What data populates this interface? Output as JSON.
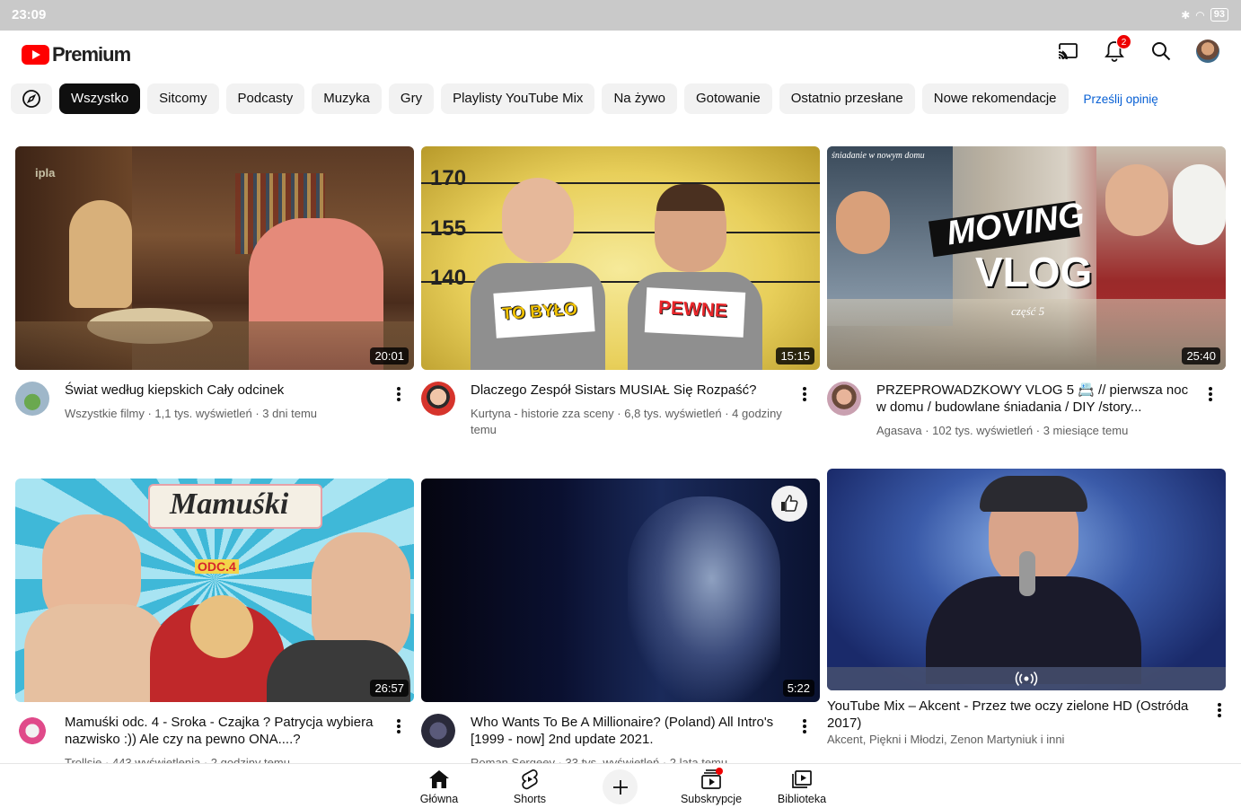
{
  "status_bar": {
    "time": "23:09",
    "battery": "93"
  },
  "header": {
    "logo_text": "Premium",
    "notification_count": "2"
  },
  "chips": {
    "items": [
      "Wszystko",
      "Sitcomy",
      "Podcasty",
      "Muzyka",
      "Gry",
      "Playlisty YouTube Mix",
      "Na żywo",
      "Gotowanie",
      "Ostatnio przesłane",
      "Nowe rekomendacje"
    ],
    "feedback_link": "Prześlij opinię"
  },
  "videos": [
    {
      "title": "Świat według kiepskich Cały odcinek",
      "subtitle": "Wszystkie filmy  · 1,1 tys. wyświetleń · 3 dni temu",
      "duration": "20:01",
      "watermark": "ipla"
    },
    {
      "title": "Dlaczego Zespół Sistars MUSIAŁ Się Rozpaść?",
      "subtitle": "Kurtyna - historie zza sceny · 6,8 tys. wyświetleń · 4 godziny temu",
      "duration": "15:15",
      "thumb_labels": [
        "170",
        "155",
        "140",
        "TO BYŁO",
        "PEWNE"
      ]
    },
    {
      "title": "PRZEPROWADZKOWY VLOG 5 📇 // pierwsza noc w domu / budowlane śniadania / DIY /story...",
      "subtitle": "Agasava · 102 tys. wyświetleń · 3 miesiące temu",
      "duration": "25:40",
      "thumb_labels": [
        "śniadanie w nowym domu",
        "MOVING",
        "VLOG",
        "część 5"
      ]
    },
    {
      "title": "Mamuśki odc. 4 - Sroka - Czajka ? Patrycja wybiera nazwisko :)) Ale czy na pewno ONA....?",
      "subtitle": "Trollsie · 443 wyświetlenia · 2 godziny temu",
      "duration": "26:57",
      "thumb_labels": [
        "Mamuśki",
        "ODC.4"
      ]
    },
    {
      "title": "Who Wants To Be A Millionaire? (Poland) All Intro's [1999 - now] 2nd update 2021.",
      "subtitle": "Roman Sergeev · 33 tys. wyświetleń · 2 lata temu",
      "duration": "5:22"
    },
    {
      "title": "YouTube Mix – Akcent - Przez twe oczy zielone HD (Ostróda 2017)",
      "subtitle": "Akcent, Piękni i Młodzi, Zenon Martyniuk i inni"
    }
  ],
  "bottom_nav": {
    "home": "Główna",
    "shorts": "Shorts",
    "subscriptions": "Subskrypcje",
    "library": "Biblioteka"
  }
}
